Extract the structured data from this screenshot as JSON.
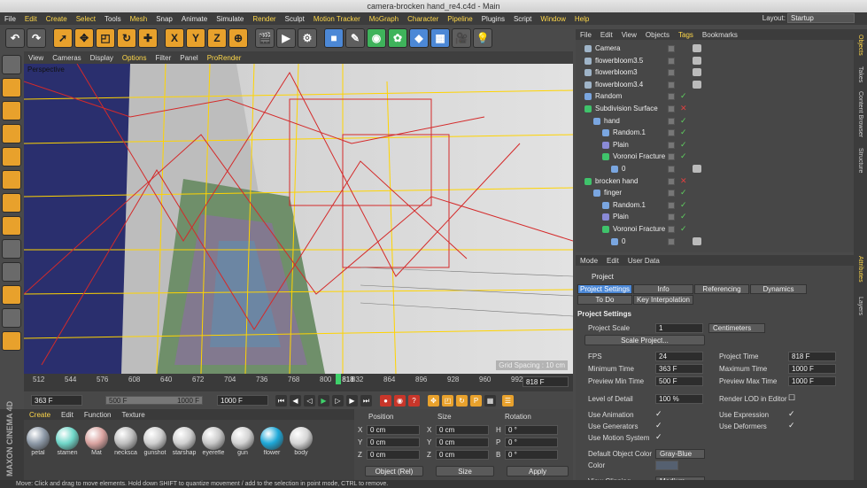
{
  "window": {
    "title": "camera-brocken hand_re4.c4d - Main"
  },
  "menubar": {
    "items": [
      "File",
      "Edit",
      "Create",
      "Select",
      "Tools",
      "Mesh",
      "Snap",
      "Animate",
      "Simulate",
      "Render",
      "Sculpt",
      "Motion Tracker",
      "MoGraph",
      "Character",
      "Pipeline",
      "Plugins",
      "Script",
      "Window",
      "Help"
    ],
    "highlighted": [
      "Edit",
      "Create",
      "Select",
      "Mesh",
      "Render",
      "Motion Tracker",
      "MoGraph",
      "Character",
      "Pipeline",
      "Window",
      "Help"
    ],
    "layout_label": "Layout:",
    "layout_value": "Startup"
  },
  "toolbar": {
    "axis_labels": [
      "X",
      "Y",
      "Z"
    ]
  },
  "viewport": {
    "menu": [
      "View",
      "Cameras",
      "Display",
      "Options",
      "Filter",
      "Panel",
      "ProRender"
    ],
    "highlighted": [
      "Options",
      "ProRender"
    ],
    "label": "Perspective",
    "grid_spacing": "Grid Spacing : 10 cm"
  },
  "timeline": {
    "ticks": [
      "512",
      "544",
      "576",
      "608",
      "640",
      "672",
      "704",
      "736",
      "768",
      "800",
      "832",
      "864",
      "896",
      "928",
      "960",
      "992"
    ],
    "current_tick": "818",
    "current_frame": "818 F",
    "start": "363 F",
    "start2": "500 F",
    "end": "1000 F",
    "end2": "1000 F"
  },
  "materials": {
    "menu": [
      "Create",
      "Edit",
      "Function",
      "Texture"
    ],
    "items": [
      {
        "label": "petal",
        "color": "#8e9aa8"
      },
      {
        "label": "stamen",
        "color": "#6fd6c8"
      },
      {
        "label": "Mat",
        "color": "#d9a3a0"
      },
      {
        "label": "necksca",
        "color": "#bfbfbf"
      },
      {
        "label": "gunshot",
        "color": "#cfcfcf"
      },
      {
        "label": "starshap",
        "color": "#d0d0d0"
      },
      {
        "label": "eyerefle",
        "color": "#c8c8c8"
      },
      {
        "label": "gun",
        "color": "#d2d2d2"
      },
      {
        "label": "flower",
        "color": "#1ea8d8"
      },
      {
        "label": "body",
        "color": "#d5d5d5"
      }
    ]
  },
  "coords": {
    "headers": [
      "Position",
      "Size",
      "Rotation"
    ],
    "rows": [
      {
        "a": "X",
        "pv": "0 cm",
        "b": "X",
        "sv": "0 cm",
        "c": "H",
        "rv": "0 °"
      },
      {
        "a": "Y",
        "pv": "0 cm",
        "b": "Y",
        "sv": "0 cm",
        "c": "P",
        "rv": "0 °"
      },
      {
        "a": "Z",
        "pv": "0 cm",
        "b": "Z",
        "sv": "0 cm",
        "c": "B",
        "rv": "0 °"
      }
    ],
    "mode": "Object (Rel)",
    "size_mode": "Size",
    "apply": "Apply"
  },
  "objects": {
    "menu": [
      "File",
      "Edit",
      "View",
      "Objects",
      "Tags",
      "Bookmarks"
    ],
    "highlighted": [
      "Tags"
    ],
    "rows": [
      {
        "name": "Camera",
        "indent": 0,
        "color": "#9fb4c8",
        "check": "",
        "tag": true
      },
      {
        "name": "flowerbloom3.5",
        "indent": 0,
        "color": "#9fb4c8",
        "check": "",
        "tag": true
      },
      {
        "name": "flowerbloom3",
        "indent": 0,
        "color": "#9fb4c8",
        "check": "",
        "tag": true
      },
      {
        "name": "flowerbloom3.4",
        "indent": 0,
        "color": "#9fb4c8",
        "check": "",
        "tag": true
      },
      {
        "name": "Random",
        "indent": 0,
        "color": "#7aa6e0",
        "check": "✓",
        "tag": false
      },
      {
        "name": "Subdivision Surface",
        "indent": 0,
        "color": "#3fc36b",
        "check": "✕",
        "tag": false
      },
      {
        "name": "hand",
        "indent": 1,
        "color": "#7aa6e0",
        "check": "✓",
        "tag": false
      },
      {
        "name": "Random.1",
        "indent": 2,
        "color": "#7aa6e0",
        "check": "✓",
        "tag": false
      },
      {
        "name": "Plain",
        "indent": 2,
        "color": "#8a8ad6",
        "check": "✓",
        "tag": false
      },
      {
        "name": "Voronoi Fracture",
        "indent": 2,
        "color": "#3fc36b",
        "check": "✓",
        "tag": false
      },
      {
        "name": "0",
        "indent": 3,
        "color": "#7aa6e0",
        "check": "",
        "tag": true
      },
      {
        "name": "brocken hand",
        "indent": 0,
        "color": "#3fc36b",
        "check": "✕",
        "tag": false
      },
      {
        "name": "finger",
        "indent": 1,
        "color": "#7aa6e0",
        "check": "✓",
        "tag": false
      },
      {
        "name": "Random.1",
        "indent": 2,
        "color": "#7aa6e0",
        "check": "✓",
        "tag": false
      },
      {
        "name": "Plain",
        "indent": 2,
        "color": "#8a8ad6",
        "check": "✓",
        "tag": false
      },
      {
        "name": "Voronoi Fracture",
        "indent": 2,
        "color": "#3fc36b",
        "check": "✓",
        "tag": false
      },
      {
        "name": "0",
        "indent": 3,
        "color": "#7aa6e0",
        "check": "",
        "tag": true
      }
    ]
  },
  "attributes": {
    "menu": [
      "Mode",
      "Edit",
      "User Data"
    ],
    "header": "Project",
    "tabs": [
      "Project Settings",
      "Info",
      "Referencing",
      "Dynamics",
      "To Do",
      "Key Interpolation"
    ],
    "section": "Project Settings",
    "project_scale_label": "Project Scale",
    "project_scale_value": "1",
    "project_scale_unit": "Centimeters",
    "scale_button": "Scale Project...",
    "fps_label": "FPS",
    "fps": "24",
    "project_time_label": "Project Time",
    "project_time": "818 F",
    "min_time_label": "Minimum Time",
    "min_time": "363 F",
    "max_time_label": "Maximum Time",
    "max_time": "1000 F",
    "prev_min_label": "Preview Min Time",
    "prev_min": "500 F",
    "prev_max_label": "Preview Max Time",
    "prev_max": "1000 F",
    "lod_label": "Level of Detail",
    "lod": "100 %",
    "render_lod_label": "Render LOD in Editor",
    "use_anim": "Use Animation",
    "use_expr": "Use Expression",
    "use_gen": "Use Generators",
    "use_def": "Use Deformers",
    "use_motion": "Use Motion System",
    "default_color_label": "Default Object Color",
    "default_color": "Gray-Blue",
    "color_label": "Color",
    "view_clip_label": "View Clipping",
    "view_clip": "Medium"
  },
  "side_tabs": [
    "Objects",
    "Takes",
    "Content Browser",
    "Structure"
  ],
  "side_tabs_lower": [
    "Attributes",
    "Layers"
  ],
  "status": "Move: Click and drag to move elements. Hold down SHIFT to quantize movement / add to the selection in point mode, CTRL to remove."
}
